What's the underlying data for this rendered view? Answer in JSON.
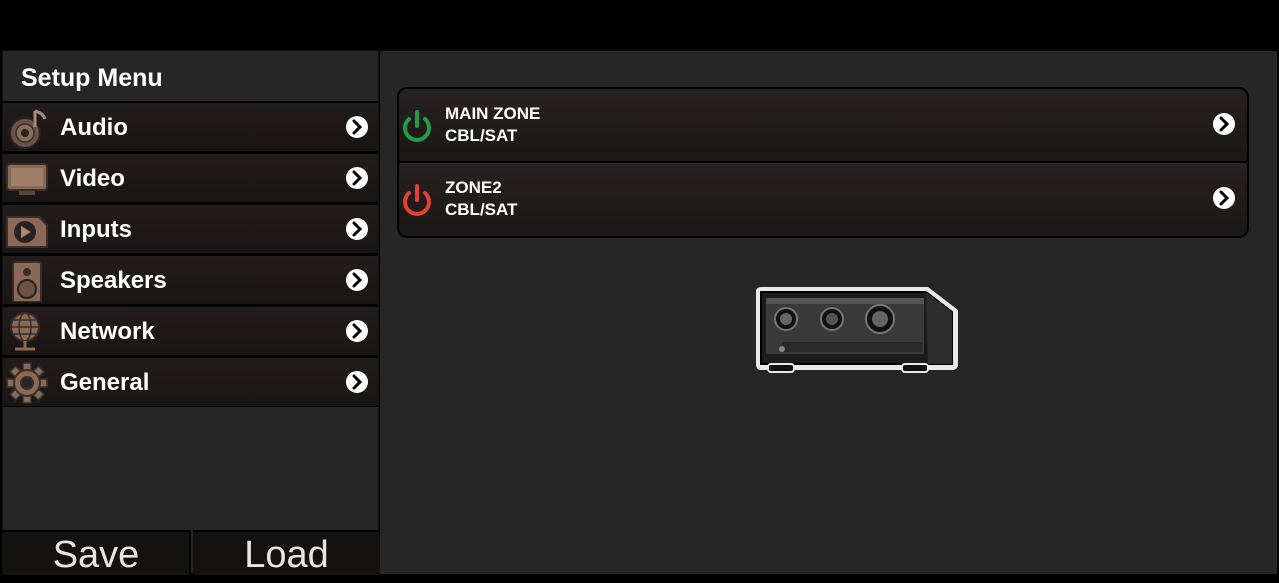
{
  "sidebar": {
    "title": "Setup Menu",
    "items": [
      {
        "label": "Audio",
        "icon": "audio-icon"
      },
      {
        "label": "Video",
        "icon": "video-icon"
      },
      {
        "label": "Inputs",
        "icon": "inputs-icon"
      },
      {
        "label": "Speakers",
        "icon": "speakers-icon"
      },
      {
        "label": "Network",
        "icon": "network-icon"
      },
      {
        "label": "General",
        "icon": "gear-icon"
      }
    ]
  },
  "footer": {
    "save_label": "Save",
    "load_label": "Load"
  },
  "zones": [
    {
      "name": "MAIN ZONE",
      "source": "CBL/SAT",
      "power": "on",
      "power_color": "#1f9e4a"
    },
    {
      "name": "ZONE2",
      "source": "CBL/SAT",
      "power": "off",
      "power_color": "#e8402f"
    }
  ],
  "colors": {
    "background": "#262626",
    "menu_text": "#ffffff",
    "chevron": "#ffffff"
  }
}
